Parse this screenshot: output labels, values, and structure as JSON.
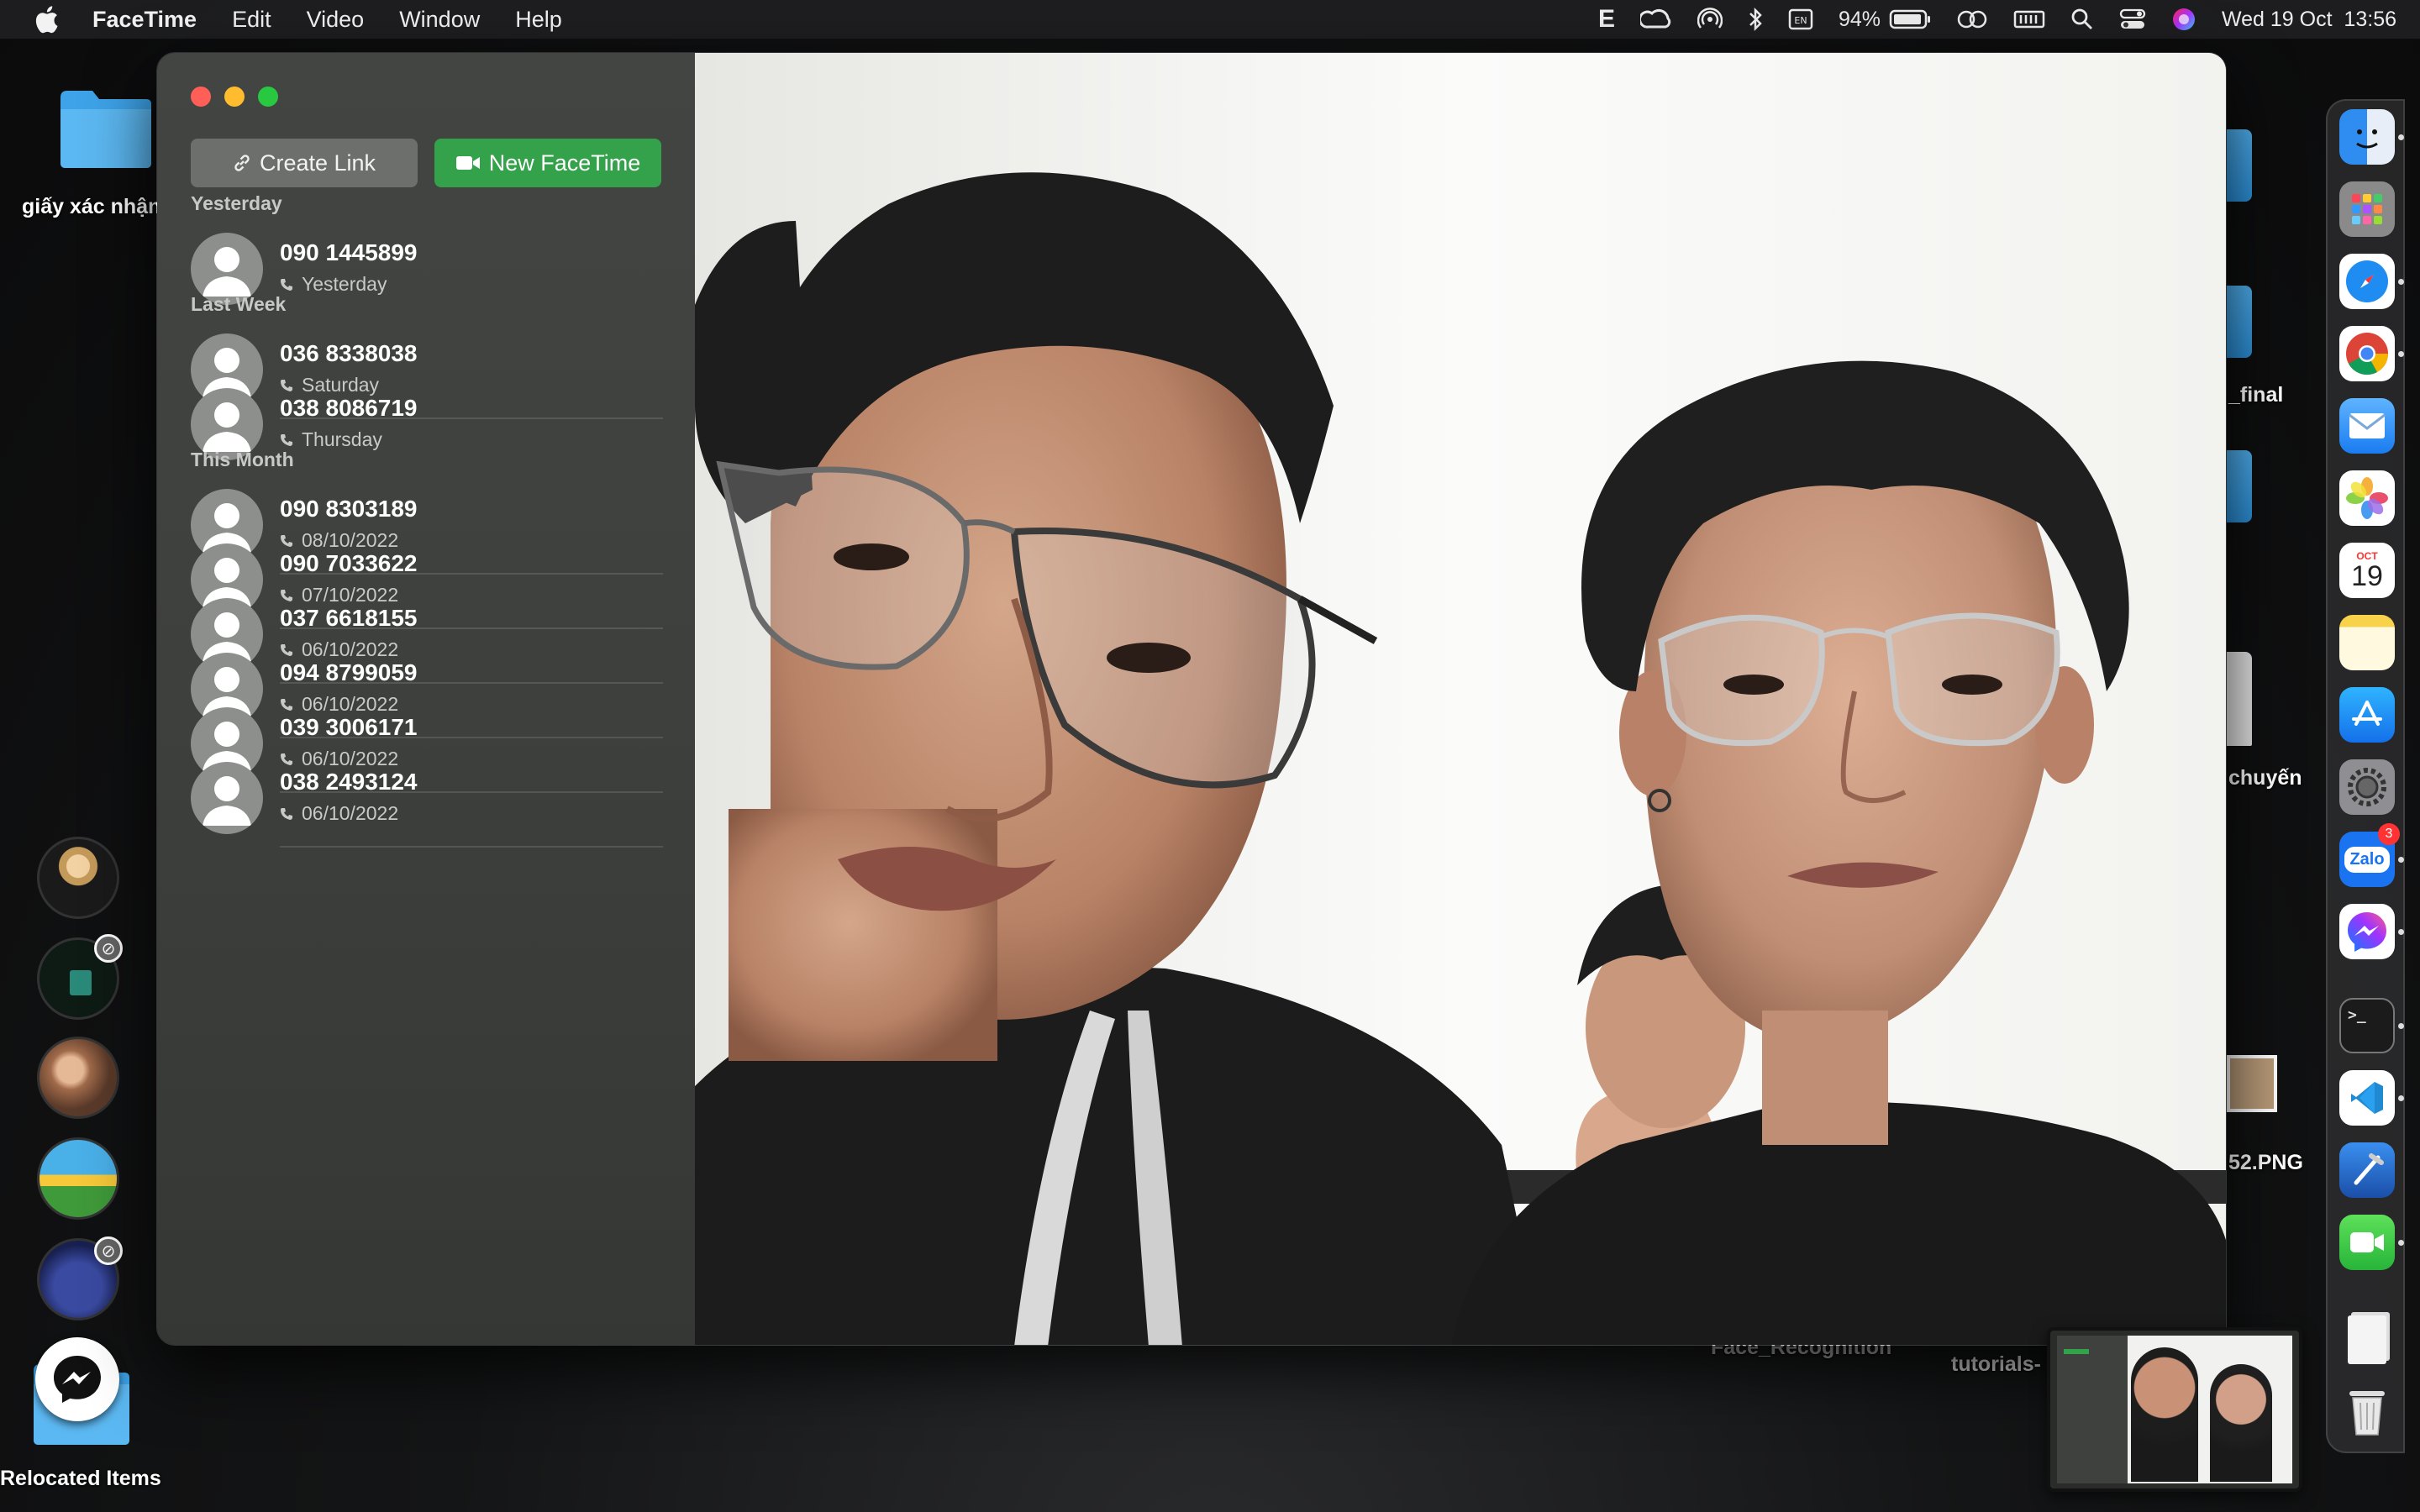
{
  "menubar": {
    "app_name": "FaceTime",
    "items": [
      "Edit",
      "Video",
      "Window",
      "Help"
    ],
    "battery": "94%",
    "datetime": "Wed 19 Oct  13:56",
    "status_icons": [
      "e-icon",
      "creative-cloud-icon",
      "airdrop-icon",
      "bluetooth-icon",
      "keyboard-input-icon",
      "battery-icon",
      "screen-mirroring-icon",
      "memory-icon",
      "search-icon",
      "control-center-icon",
      "siri-icon"
    ]
  },
  "desktop": {
    "left_folder_label": "giấy xác nhận",
    "relocated_label": "Relocated Items",
    "right_labels": [
      "_final",
      "chuyến",
      "52.PNG"
    ],
    "bottom_labels": [
      "Face_Recognition",
      "tutorials-"
    ]
  },
  "facetime": {
    "buttons": {
      "create_link": "Create Link",
      "new_facetime": "New FaceTime"
    },
    "sections": [
      {
        "title": "Yesterday",
        "calls": [
          {
            "number": "090 1445899",
            "when": "Yesterday"
          }
        ]
      },
      {
        "title": "Last Week",
        "calls": [
          {
            "number": "036 8338038",
            "when": "Saturday"
          },
          {
            "number": "038 8086719",
            "when": "Thursday"
          }
        ]
      },
      {
        "title": "This Month",
        "calls": [
          {
            "number": "090 8303189",
            "when": "08/10/2022"
          },
          {
            "number": "090 7033622",
            "when": "07/10/2022"
          },
          {
            "number": "037 6618155",
            "when": "06/10/2022"
          },
          {
            "number": "094 8799059",
            "when": "06/10/2022"
          },
          {
            "number": "039 3006171",
            "when": "06/10/2022"
          },
          {
            "number": "038 2493124",
            "when": "06/10/2022"
          }
        ]
      }
    ]
  },
  "dock": {
    "apps": [
      "finder",
      "launchpad",
      "safari",
      "chrome",
      "mail",
      "photos",
      "calendar",
      "notes",
      "app-store",
      "system-preferences",
      "zalo",
      "messenger",
      "terminal",
      "vscode",
      "xcode",
      "facetime",
      "documents",
      "trash"
    ],
    "calendar_month": "OCT",
    "calendar_day": "19",
    "zalo_label": "Zalo",
    "zalo_badge": "3",
    "terminal_prompt": ">_"
  },
  "colors": {
    "accent_green": "#33a24a",
    "close": "#ff5f57",
    "minimize": "#febc2e",
    "zoom": "#28c840"
  }
}
